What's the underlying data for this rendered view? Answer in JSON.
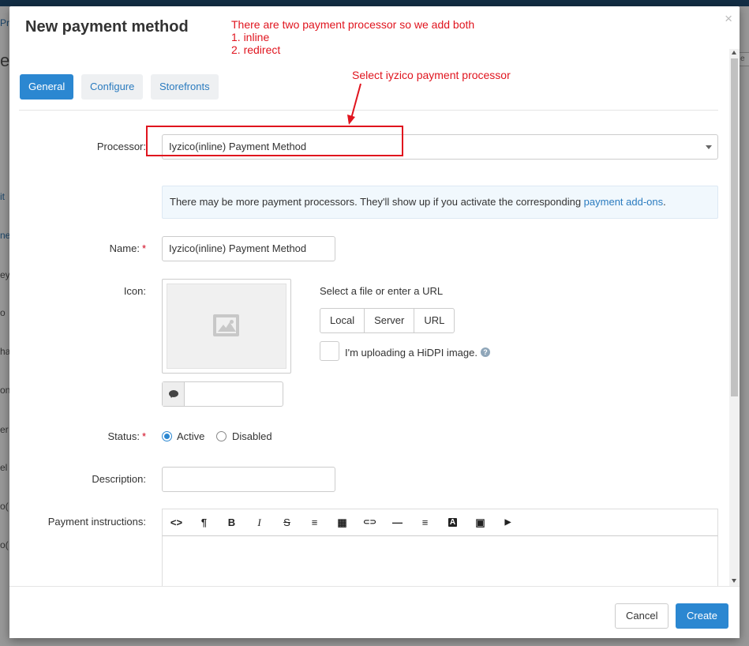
{
  "background": {
    "fragments": [
      "Pr",
      "e",
      "",
      "it",
      "ne",
      "ey",
      "o",
      "ha",
      "on",
      "er",
      "el",
      "o(",
      "o("
    ],
    "right_fragment": "e"
  },
  "modal": {
    "title": "New payment method",
    "close_symbol": "×",
    "tabs": [
      {
        "label": "General",
        "active": true
      },
      {
        "label": "Configure",
        "active": false
      },
      {
        "label": "Storefronts",
        "active": false
      }
    ],
    "processor": {
      "label": "Processor:",
      "value": "Iyzico(inline) Payment Method"
    },
    "info": {
      "text": "There may be more payment processors. They'll show up if you activate the corresponding ",
      "link": "payment add-ons",
      "suffix": "."
    },
    "name": {
      "label": "Name:",
      "required": "*",
      "value": "Iyzico(inline) Payment Method"
    },
    "icon": {
      "label": "Icon:",
      "file_label": "Select a file or enter a URL",
      "buttons": [
        "Local",
        "Server",
        "URL"
      ],
      "hidpi_label": "I'm uploading a HiDPI image.",
      "help": "?"
    },
    "status": {
      "label": "Status:",
      "required": "*",
      "options": [
        {
          "label": "Active",
          "selected": true
        },
        {
          "label": "Disabled",
          "selected": false
        }
      ]
    },
    "description": {
      "label": "Description:",
      "value": ""
    },
    "payment_instructions": {
      "label": "Payment instructions:",
      "toolbar": [
        {
          "icon": "code-view-icon",
          "glyph": "<>"
        },
        {
          "icon": "paragraph-icon",
          "glyph": "¶"
        },
        {
          "icon": "bold-icon",
          "glyph": "B"
        },
        {
          "icon": "italic-icon",
          "glyph": "I"
        },
        {
          "icon": "strikethrough-icon",
          "glyph": "S"
        },
        {
          "icon": "unordered-list-icon",
          "glyph": "≡"
        },
        {
          "icon": "table-icon",
          "glyph": "▦"
        },
        {
          "icon": "link-icon",
          "glyph": "⊂⊃"
        },
        {
          "icon": "horizontal-rule-icon",
          "glyph": "—"
        },
        {
          "icon": "align-icon",
          "glyph": "≡"
        },
        {
          "icon": "font-color-icon",
          "glyph": "A"
        },
        {
          "icon": "image-icon",
          "glyph": "▣"
        },
        {
          "icon": "video-icon",
          "glyph": "▶"
        }
      ]
    },
    "footer": {
      "cancel": "Cancel",
      "create": "Create"
    }
  },
  "annotations": {
    "note_lines": [
      "There are two payment processor so we add both",
      "1. inline",
      "2. redirect"
    ],
    "select_note": "Select iyzico payment  processor",
    "color": "#e0141e"
  }
}
